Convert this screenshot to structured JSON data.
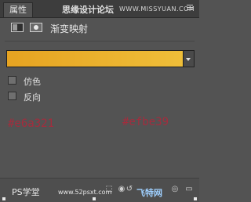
{
  "panel": {
    "tab_label": "属性",
    "watermark_top": "思缘设计论坛",
    "watermark_top_url": "WWW.MISSYUAN.COM",
    "menu_icon": "panel-menu-icon"
  },
  "adjustment": {
    "title": "渐变映射",
    "icons": [
      "adjustment-layer-icon",
      "mask-icon"
    ]
  },
  "gradient": {
    "start_color": "#e6a321",
    "end_color": "#efbe39"
  },
  "options": [
    {
      "label": "仿色",
      "checked": false
    },
    {
      "label": "反向",
      "checked": false
    }
  ],
  "annotations": {
    "left_hex": "#e6a321",
    "right_hex": "#efbe39"
  },
  "bottom": {
    "watermark_left": "PS学堂",
    "watermark_url": "www.52psxt.com",
    "watermark_right": "飞特网",
    "icons": [
      "clip-icon",
      "view-previous-icon",
      "reset-icon",
      "visibility-icon",
      "delete-icon"
    ]
  }
}
